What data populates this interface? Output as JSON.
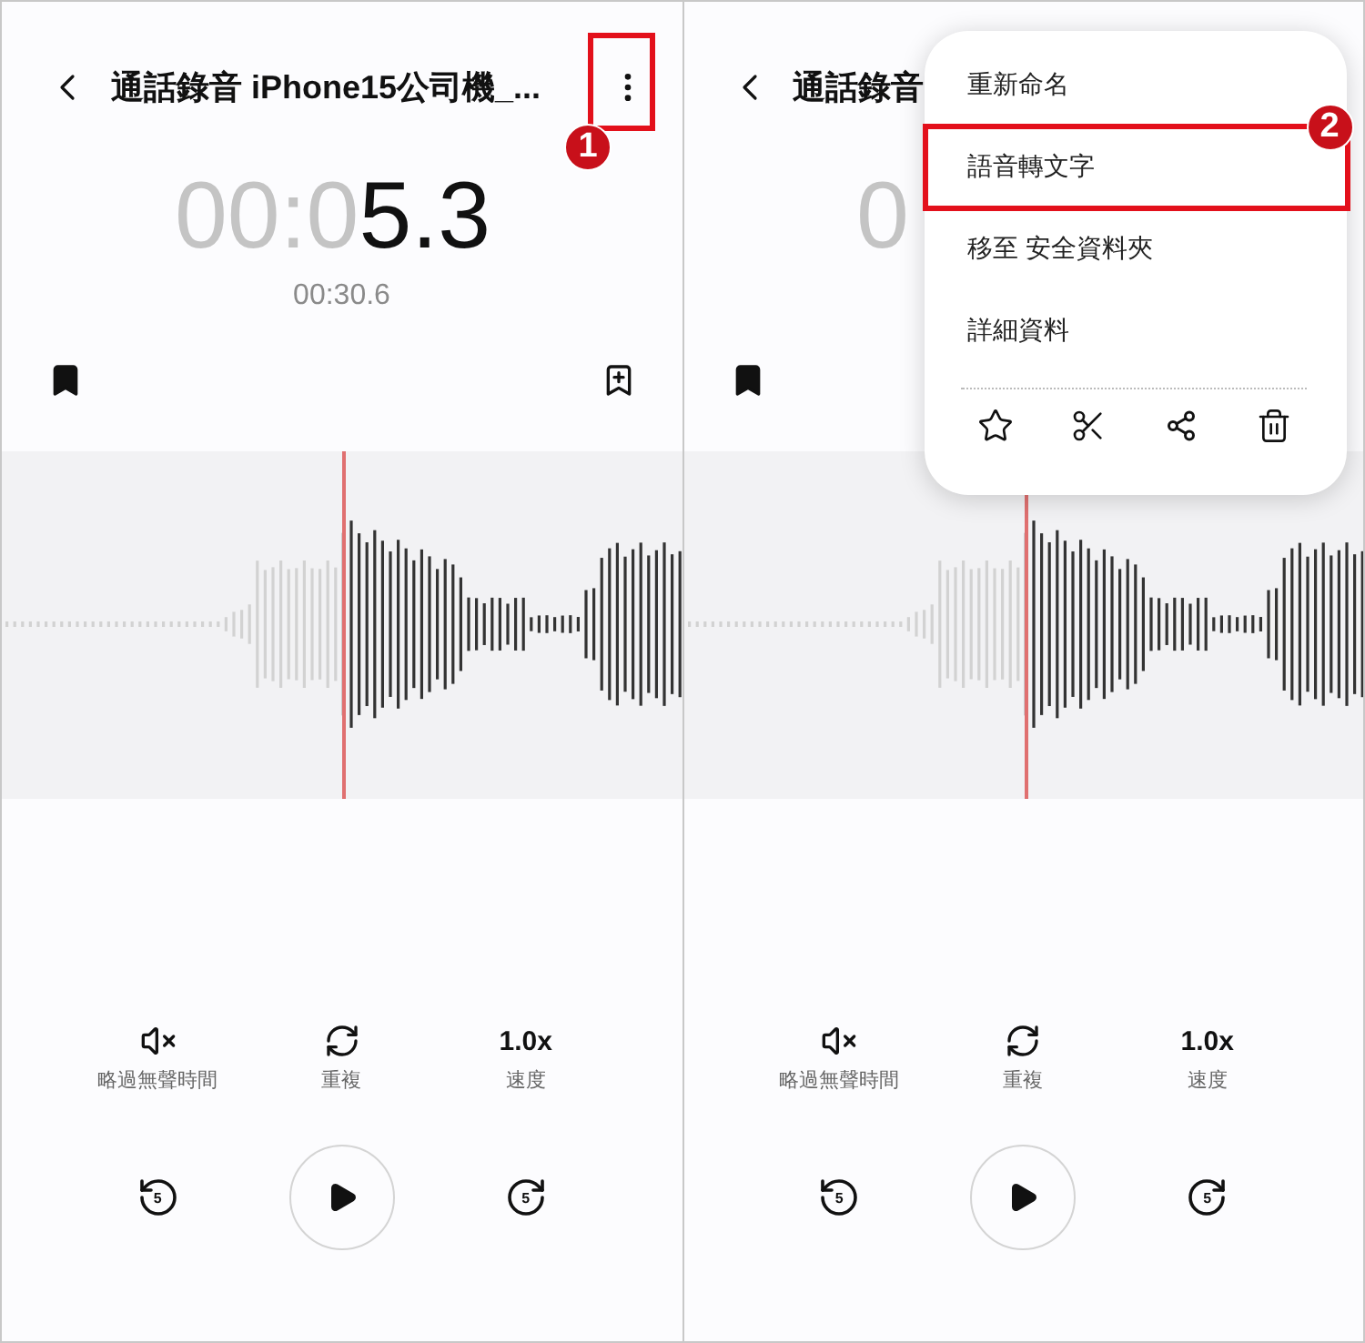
{
  "panels": [
    {
      "title": "通話錄音 iPhone15公司機_...",
      "more_button_visible": true,
      "time_dim": "00:0",
      "time_bold": "5.3",
      "total": "00:30.6",
      "add_bookmark_visible": true,
      "controls": [
        {
          "kind": "skip-silence",
          "label": "略過無聲時間"
        },
        {
          "kind": "repeat",
          "label": "重複"
        },
        {
          "kind": "speed",
          "value": "1.0x",
          "label": "速度"
        }
      ],
      "rewind": "5",
      "forward": "5",
      "annotation": {
        "badge": "1"
      }
    },
    {
      "title": "通話錄音",
      "more_button_visible": false,
      "time_dim": "0",
      "add_bookmark_visible": false,
      "controls": [
        {
          "kind": "skip-silence",
          "label": "略過無聲時間"
        },
        {
          "kind": "repeat",
          "label": "重複"
        },
        {
          "kind": "speed",
          "value": "1.0x",
          "label": "速度"
        }
      ],
      "rewind": "5",
      "forward": "5",
      "menu": {
        "items": [
          {
            "label": "重新命名",
            "highlighted": false
          },
          {
            "label": "語音轉文字",
            "highlighted": true
          },
          {
            "label": "移至 安全資料夾",
            "highlighted": false
          },
          {
            "label": "詳細資料",
            "highlighted": false
          }
        ]
      },
      "annotation": {
        "badge": "2"
      }
    }
  ]
}
